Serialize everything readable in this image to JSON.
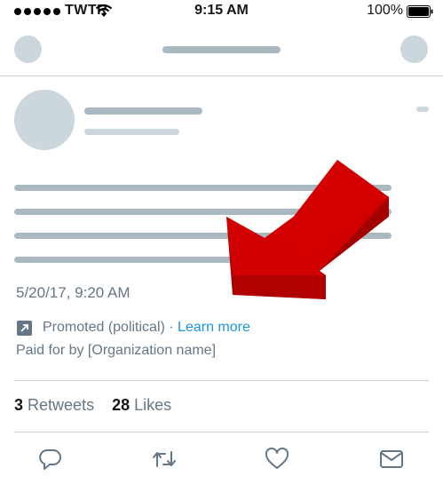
{
  "status_bar": {
    "carrier": "TWTR",
    "time": "9:15 AM",
    "battery": "100%"
  },
  "tweet": {
    "timestamp": "5/20/17, 9:20 AM",
    "promoted_label": "Promoted (political)",
    "separator": " · ",
    "learn_more": "Learn more",
    "paid_for": "Paid for by [Organization name]",
    "retweets_count": "3",
    "retweets_label": "Retweets",
    "likes_count": "28",
    "likes_label": "Likes"
  },
  "actions": [
    "reply-icon",
    "retweet-icon",
    "like-icon",
    "direct-message-icon"
  ],
  "colors": {
    "placeholder_dark": "#aab8c2",
    "placeholder_light": "#ccd6dd",
    "meta_text": "#657786",
    "link": "#1b95e0",
    "arrow": "#cc0000"
  }
}
